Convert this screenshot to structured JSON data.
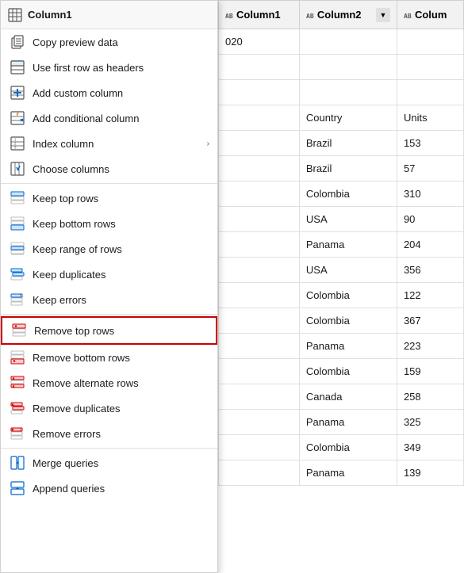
{
  "menu": {
    "header": {
      "label": "Column1",
      "icon": "table-icon"
    },
    "items": [
      {
        "id": "copy-preview",
        "label": "Copy preview data",
        "icon": "copy-icon",
        "hasArrow": false,
        "dividerAfter": false
      },
      {
        "id": "first-row-headers",
        "label": "Use first row as headers",
        "icon": "header-icon",
        "hasArrow": false,
        "dividerAfter": false
      },
      {
        "id": "add-custom-col",
        "label": "Add custom column",
        "icon": "custom-col-icon",
        "hasArrow": false,
        "dividerAfter": false
      },
      {
        "id": "add-conditional-col",
        "label": "Add conditional column",
        "icon": "conditional-col-icon",
        "hasArrow": false,
        "dividerAfter": false
      },
      {
        "id": "index-column",
        "label": "Index column",
        "icon": "index-icon",
        "hasArrow": true,
        "dividerAfter": false
      },
      {
        "id": "choose-columns",
        "label": "Choose columns",
        "icon": "choose-cols-icon",
        "hasArrow": false,
        "dividerAfter": true
      },
      {
        "id": "keep-top-rows",
        "label": "Keep top rows",
        "icon": "keep-top-icon",
        "hasArrow": false,
        "dividerAfter": false
      },
      {
        "id": "keep-bottom-rows",
        "label": "Keep bottom rows",
        "icon": "keep-bottom-icon",
        "hasArrow": false,
        "dividerAfter": false
      },
      {
        "id": "keep-range-rows",
        "label": "Keep range of rows",
        "icon": "keep-range-icon",
        "hasArrow": false,
        "dividerAfter": false
      },
      {
        "id": "keep-duplicates",
        "label": "Keep duplicates",
        "icon": "keep-dupes-icon",
        "hasArrow": false,
        "dividerAfter": false
      },
      {
        "id": "keep-errors",
        "label": "Keep errors",
        "icon": "keep-errors-icon",
        "hasArrow": false,
        "dividerAfter": true
      },
      {
        "id": "remove-top-rows",
        "label": "Remove top rows",
        "icon": "remove-top-icon",
        "hasArrow": false,
        "dividerAfter": false,
        "highlighted": true
      },
      {
        "id": "remove-bottom-rows",
        "label": "Remove bottom rows",
        "icon": "remove-bottom-icon",
        "hasArrow": false,
        "dividerAfter": false
      },
      {
        "id": "remove-alternate-rows",
        "label": "Remove alternate rows",
        "icon": "remove-alt-icon",
        "hasArrow": false,
        "dividerAfter": false
      },
      {
        "id": "remove-duplicates",
        "label": "Remove duplicates",
        "icon": "remove-dupes-icon",
        "hasArrow": false,
        "dividerAfter": false
      },
      {
        "id": "remove-errors",
        "label": "Remove errors",
        "icon": "remove-errors-icon",
        "hasArrow": false,
        "dividerAfter": true
      },
      {
        "id": "merge-queries",
        "label": "Merge queries",
        "icon": "merge-icon",
        "hasArrow": false,
        "dividerAfter": false
      },
      {
        "id": "append-queries",
        "label": "Append queries",
        "icon": "append-icon",
        "hasArrow": false,
        "dividerAfter": false
      }
    ]
  },
  "table": {
    "columns": [
      {
        "id": "col1",
        "label": "Column1",
        "type": "text",
        "showFilter": false,
        "truncated": false
      },
      {
        "id": "col2",
        "label": "Column2",
        "type": "text",
        "showFilter": true,
        "truncated": false
      },
      {
        "id": "col3",
        "label": "Colum",
        "type": "text",
        "showFilter": false,
        "truncated": true
      }
    ],
    "rows": [
      {
        "col1": "020",
        "col2": "",
        "col3": ""
      },
      {
        "col1": "",
        "col2": "",
        "col3": ""
      },
      {
        "col1": "",
        "col2": "",
        "col3": ""
      },
      {
        "col1": "",
        "col2": "Country",
        "col3": "Units"
      },
      {
        "col1": "",
        "col2": "Brazil",
        "col3": "153"
      },
      {
        "col1": "",
        "col2": "Brazil",
        "col3": "57"
      },
      {
        "col1": "",
        "col2": "Colombia",
        "col3": "310"
      },
      {
        "col1": "",
        "col2": "USA",
        "col3": "90"
      },
      {
        "col1": "",
        "col2": "Panama",
        "col3": "204"
      },
      {
        "col1": "",
        "col2": "USA",
        "col3": "356"
      },
      {
        "col1": "",
        "col2": "Colombia",
        "col3": "122"
      },
      {
        "col1": "",
        "col2": "Colombia",
        "col3": "367"
      },
      {
        "col1": "",
        "col2": "Panama",
        "col3": "223"
      },
      {
        "col1": "",
        "col2": "Colombia",
        "col3": "159"
      },
      {
        "col1": "",
        "col2": "Canada",
        "col3": "258"
      },
      {
        "col1": "",
        "col2": "Panama",
        "col3": "325"
      },
      {
        "col1": "",
        "col2": "Colombia",
        "col3": "349"
      },
      {
        "col1": "",
        "col2": "Panama",
        "col3": "139"
      }
    ]
  },
  "colors": {
    "accent_blue": "#0078d4",
    "highlight_red": "#cc0000",
    "menu_bg": "#ffffff",
    "table_header_bg": "#f2f2f2",
    "icon_blue": "#0066cc",
    "icon_orange": "#d07020",
    "icon_green": "#107c10"
  }
}
